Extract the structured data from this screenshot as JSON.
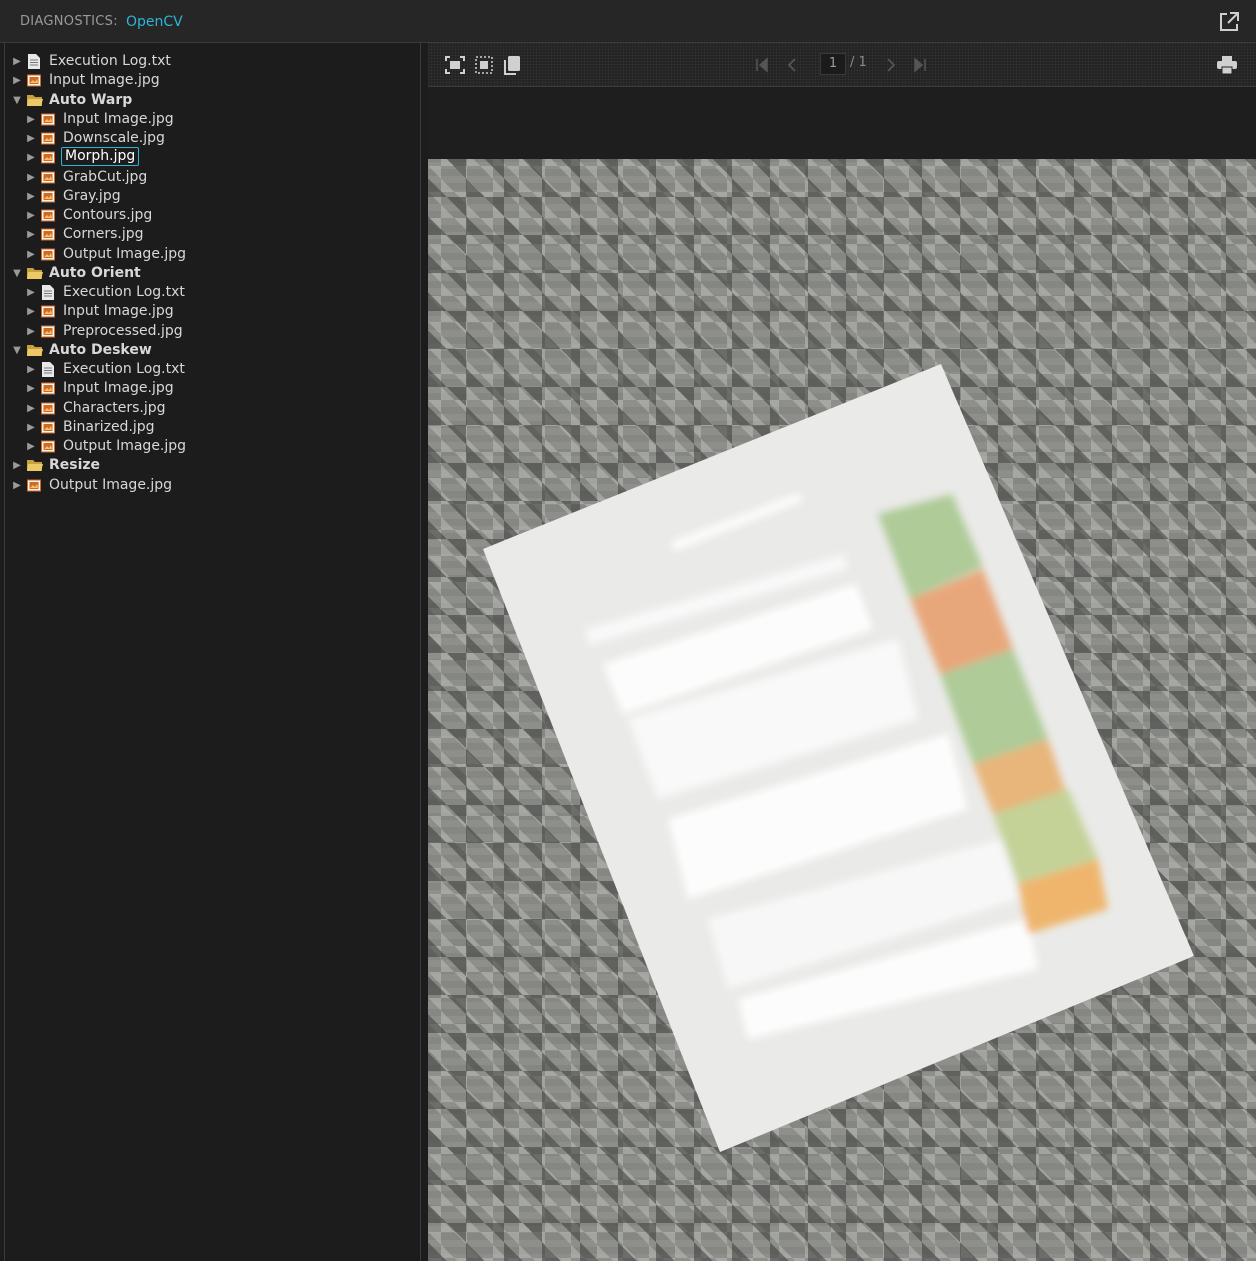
{
  "header": {
    "label": "DIAGNOSTICS:",
    "product": "OpenCV"
  },
  "tree": [
    {
      "label": "Execution Log.txt",
      "type": "file-text",
      "depth": 0,
      "bold": false,
      "selected": false
    },
    {
      "label": "Input Image.jpg",
      "type": "image",
      "depth": 0,
      "bold": false,
      "selected": false
    },
    {
      "label": "Auto Warp",
      "type": "folder",
      "depth": 0,
      "bold": true,
      "selected": false,
      "expanded": true
    },
    {
      "label": "Input Image.jpg",
      "type": "image",
      "depth": 1,
      "bold": false,
      "selected": false
    },
    {
      "label": "Downscale.jpg",
      "type": "image",
      "depth": 1,
      "bold": false,
      "selected": false
    },
    {
      "label": "Morph.jpg",
      "type": "image",
      "depth": 1,
      "bold": false,
      "selected": true
    },
    {
      "label": "GrabCut.jpg",
      "type": "image",
      "depth": 1,
      "bold": false,
      "selected": false
    },
    {
      "label": "Gray.jpg",
      "type": "image",
      "depth": 1,
      "bold": false,
      "selected": false
    },
    {
      "label": "Contours.jpg",
      "type": "image",
      "depth": 1,
      "bold": false,
      "selected": false
    },
    {
      "label": "Corners.jpg",
      "type": "image",
      "depth": 1,
      "bold": false,
      "selected": false
    },
    {
      "label": "Output Image.jpg",
      "type": "image",
      "depth": 1,
      "bold": false,
      "selected": false
    },
    {
      "label": "Auto Orient",
      "type": "folder",
      "depth": 0,
      "bold": true,
      "selected": false,
      "expanded": true
    },
    {
      "label": "Execution Log.txt",
      "type": "file-text",
      "depth": 1,
      "bold": false,
      "selected": false
    },
    {
      "label": "Input Image.jpg",
      "type": "image",
      "depth": 1,
      "bold": false,
      "selected": false
    },
    {
      "label": "Preprocessed.jpg",
      "type": "image",
      "depth": 1,
      "bold": false,
      "selected": false
    },
    {
      "label": "Auto Deskew",
      "type": "folder",
      "depth": 0,
      "bold": true,
      "selected": false,
      "expanded": true
    },
    {
      "label": "Execution Log.txt",
      "type": "file-text",
      "depth": 1,
      "bold": false,
      "selected": false
    },
    {
      "label": "Input Image.jpg",
      "type": "image",
      "depth": 1,
      "bold": false,
      "selected": false
    },
    {
      "label": "Characters.jpg",
      "type": "image",
      "depth": 1,
      "bold": false,
      "selected": false
    },
    {
      "label": "Binarized.jpg",
      "type": "image",
      "depth": 1,
      "bold": false,
      "selected": false
    },
    {
      "label": "Output Image.jpg",
      "type": "image",
      "depth": 1,
      "bold": false,
      "selected": false
    },
    {
      "label": "Resize",
      "type": "folder",
      "depth": 0,
      "bold": true,
      "selected": false,
      "expanded": false
    },
    {
      "label": "Output Image.jpg",
      "type": "image",
      "depth": 0,
      "bold": false,
      "selected": false
    }
  ],
  "viewer": {
    "page_current": "1",
    "page_total": "/ 1",
    "icons": [
      "fit-page-icon",
      "actual-size-icon",
      "copy-icon",
      "first-page-icon",
      "prev-page-icon",
      "next-page-icon",
      "last-page-icon",
      "print-icon"
    ]
  },
  "colors": {
    "accent": "#2cb5d8",
    "background": "#1c1c1c",
    "folder": "#e8c060",
    "image_icon": "#d2691e"
  }
}
